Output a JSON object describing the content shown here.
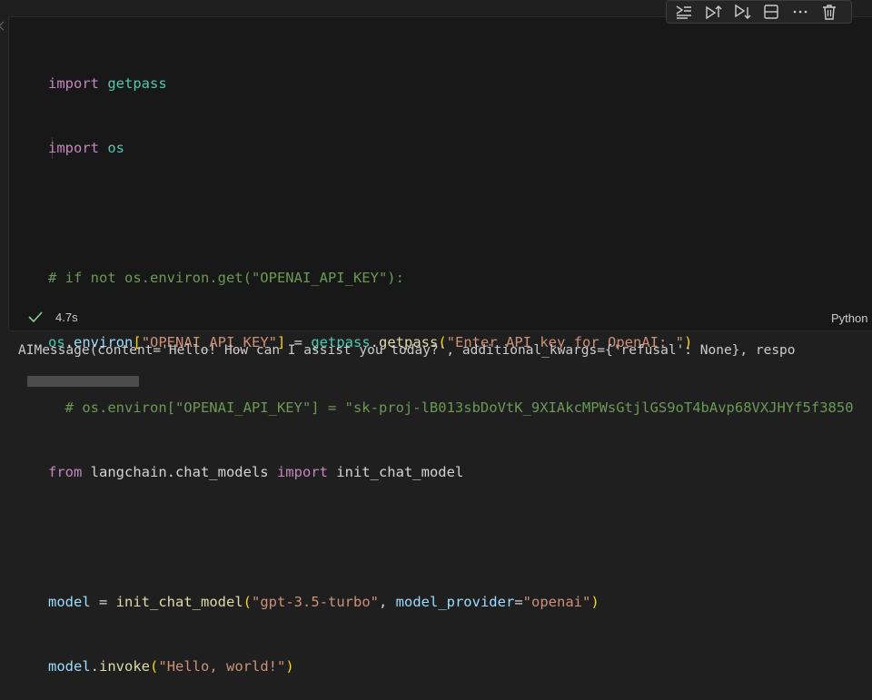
{
  "toolbar": {
    "buttons": [
      {
        "name": "run-by-line-icon"
      },
      {
        "name": "execute-above-icon"
      },
      {
        "name": "execute-below-icon"
      },
      {
        "name": "split-cell-icon"
      },
      {
        "name": "more-actions-icon"
      },
      {
        "name": "delete-cell-icon"
      }
    ]
  },
  "code": {
    "l1_kw": "import",
    "l1_mod": "getpass",
    "l2_kw": "import",
    "l2_mod": "os",
    "l4_comment": "# if not os.environ.get(\"OPENAI_API_KEY\"):",
    "l5_var1": "os",
    "l5_dot1": ".",
    "l5_var2": "environ",
    "l5_br1": "[",
    "l5_str1": "\"OPENAI_API_KEY\"",
    "l5_br2": "]",
    "l5_eq": " = ",
    "l5_mod": "getpass",
    "l5_dot2": ".",
    "l5_fn": "getpass",
    "l5_p1": "(",
    "l5_str2": "\"Enter API key for OpenAI: \"",
    "l5_p2": ")",
    "l6_comment": "  # os.environ[\"OPENAI_API_KEY\"] = \"sk-proj-lB013sbDoVtK_9XIAkcMPWsGtjlGS9oT4bAvp68VXJHYf5f3850",
    "l7_kw1": "from",
    "l7_mod": " langchain.chat_models ",
    "l7_kw2": "import",
    "l7_name": " init_chat_model",
    "l9_var": "model",
    "l9_eq": " = ",
    "l9_fn": "init_chat_model",
    "l9_p1": "(",
    "l9_str1": "\"gpt-3.5-turbo\"",
    "l9_comma": ", ",
    "l9_param": "model_provider",
    "l9_eq2": "=",
    "l9_str2": "\"openai\"",
    "l9_p2": ")",
    "l10_var": "model",
    "l10_dot": ".",
    "l10_fn": "invoke",
    "l10_p1": "(",
    "l10_str": "\"Hello, world!\"",
    "l10_p2": ")"
  },
  "status": {
    "icon": "checkmark-icon",
    "time": "4.7s",
    "success_color": "#89d185"
  },
  "language": "Python",
  "output": "AIMessage(content='Hello! How can I assist you today?', additional_kwargs={'refusal': None}, respo"
}
